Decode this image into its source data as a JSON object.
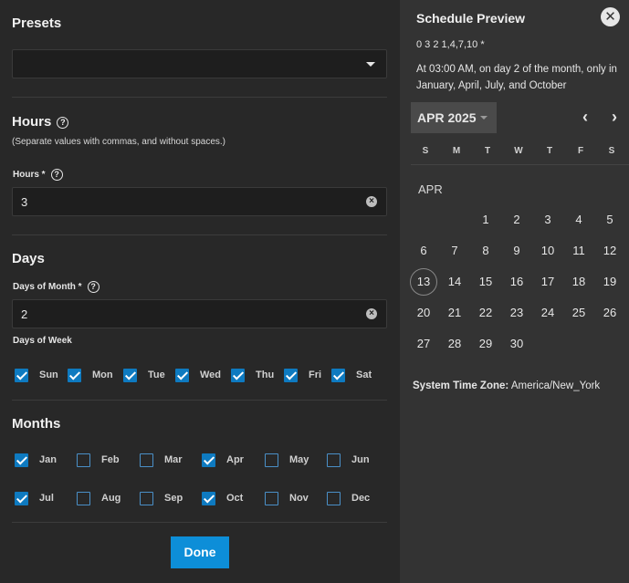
{
  "presets": {
    "title": "Presets",
    "value": ""
  },
  "hours": {
    "title": "Hours",
    "hint": "(Separate values with commas, and without spaces.)",
    "field_label": "Hours *",
    "value": "3"
  },
  "days": {
    "title": "Days",
    "field_label": "Days of Month *",
    "value": "2",
    "week_label": "Days of Week",
    "week": [
      {
        "label": "Sun",
        "checked": true
      },
      {
        "label": "Mon",
        "checked": true
      },
      {
        "label": "Tue",
        "checked": true
      },
      {
        "label": "Wed",
        "checked": true
      },
      {
        "label": "Thu",
        "checked": true
      },
      {
        "label": "Fri",
        "checked": true
      },
      {
        "label": "Sat",
        "checked": true
      }
    ]
  },
  "months": {
    "title": "Months",
    "row1": [
      {
        "label": "Jan",
        "checked": true
      },
      {
        "label": "Feb",
        "checked": false
      },
      {
        "label": "Mar",
        "checked": false
      },
      {
        "label": "Apr",
        "checked": true
      },
      {
        "label": "May",
        "checked": false
      },
      {
        "label": "Jun",
        "checked": false
      }
    ],
    "row2": [
      {
        "label": "Jul",
        "checked": true
      },
      {
        "label": "Aug",
        "checked": false
      },
      {
        "label": "Sep",
        "checked": false
      },
      {
        "label": "Oct",
        "checked": true
      },
      {
        "label": "Nov",
        "checked": false
      },
      {
        "label": "Dec",
        "checked": false
      }
    ]
  },
  "done_label": "Done",
  "preview": {
    "title": "Schedule Preview",
    "close_glyph": "✕",
    "cron": "0 3 2 1,4,7,10 *",
    "description": "At 03:00 AM, on day 2 of the month, only in January, April, July, and October",
    "month_button": "APR 2025",
    "prev_glyph": "‹",
    "next_glyph": "›",
    "weekdays": [
      "S",
      "M",
      "T",
      "W",
      "T",
      "F",
      "S"
    ],
    "month_label": "APR",
    "weeks": [
      [
        "",
        "",
        "1",
        "2",
        "3",
        "4",
        "5"
      ],
      [
        "6",
        "7",
        "8",
        "9",
        "10",
        "11",
        "12"
      ],
      [
        "13",
        "14",
        "15",
        "16",
        "17",
        "18",
        "19"
      ],
      [
        "20",
        "21",
        "22",
        "23",
        "24",
        "25",
        "26"
      ],
      [
        "27",
        "28",
        "29",
        "30",
        "",
        "",
        ""
      ]
    ],
    "today": "13",
    "tz_label": "System Time Zone:",
    "tz_value": "America/New_York"
  },
  "colors": {
    "accent": "#0d8ed8",
    "checkbox": "#0e7ac0"
  }
}
